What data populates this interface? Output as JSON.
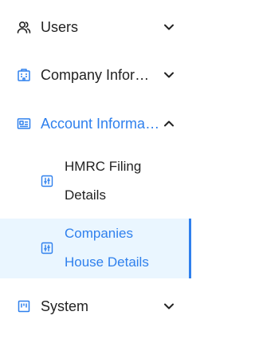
{
  "menu": {
    "users": {
      "label": "Users",
      "icon": "users-icon",
      "expanded": false
    },
    "company_information": {
      "label": "Company Inform…",
      "icon": "building-icon",
      "expanded": false
    },
    "account_information": {
      "label": "Account Informa…",
      "icon": "id-card-icon",
      "expanded": true,
      "children": [
        {
          "label_line1": "HMRC Filing",
          "label_line2": "Details",
          "icon": "sliders-icon",
          "selected": false
        },
        {
          "label_line1": "Companies",
          "label_line2": "House Details",
          "icon": "sliders-icon",
          "selected": true
        }
      ]
    },
    "system": {
      "label": "System",
      "icon": "system-icon",
      "expanded": false
    }
  },
  "colors": {
    "accent": "#2f80ed",
    "text": "#222222",
    "selected_bg": "#eaf6ff"
  }
}
